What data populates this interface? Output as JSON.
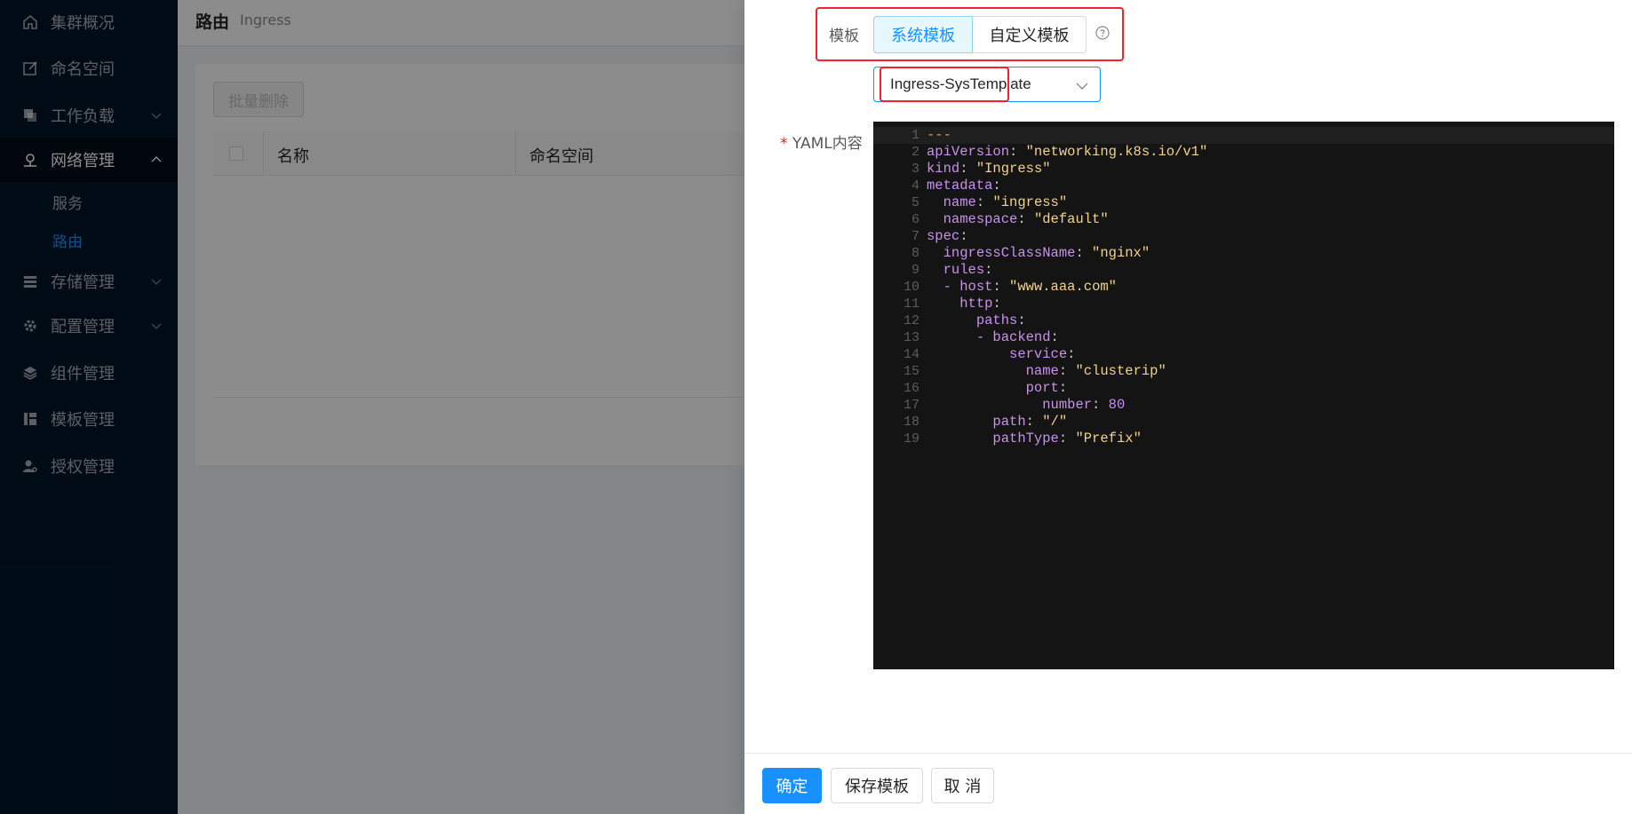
{
  "sidebar": {
    "items": [
      {
        "label": "集群概况",
        "icon": "home-icon"
      },
      {
        "label": "命名空间",
        "icon": "edit-icon"
      },
      {
        "label": "工作负载",
        "icon": "copy-icon"
      },
      {
        "label": "网络管理",
        "icon": "network-icon"
      },
      {
        "label": "存储管理",
        "icon": "database-icon"
      },
      {
        "label": "配置管理",
        "icon": "gear-icon"
      },
      {
        "label": "组件管理",
        "icon": "layers-icon"
      },
      {
        "label": "模板管理",
        "icon": "layout-icon"
      },
      {
        "label": "授权管理",
        "icon": "user-key-icon"
      }
    ],
    "sub_items": [
      {
        "label": "服务"
      },
      {
        "label": "路由"
      }
    ]
  },
  "page": {
    "title": "路由",
    "subtitle": "Ingress",
    "batch_delete": "批量删除",
    "columns": [
      "名称",
      "命名空间"
    ]
  },
  "drawer": {
    "template_label": "模板",
    "template_options": [
      "系统模板",
      "自定义模板"
    ],
    "selected_template": "Ingress-SysTemplate",
    "yaml_label": "YAML内容",
    "required_mark": "*",
    "yaml_lines": [
      "---",
      "apiVersion: \"networking.k8s.io/v1\"",
      "kind: \"Ingress\"",
      "metadata:",
      "  name: \"ingress\"",
      "  namespace: \"default\"",
      "spec:",
      "  ingressClassName: \"nginx\"",
      "  rules:",
      "  - host: \"www.aaa.com\"",
      "    http:",
      "      paths:",
      "      - backend:",
      "          service:",
      "            name: \"clusterip\"",
      "            port:",
      "              number: 80",
      "        path: \"/\"",
      "        pathType: \"Prefix\""
    ],
    "buttons": {
      "confirm": "确定",
      "save_template": "保存模板",
      "cancel": "取 消"
    }
  },
  "colors": {
    "primary": "#1890ff",
    "sidebar_bg": "#001529",
    "highlight_box": "#f5222d",
    "editor_bg": "#141414"
  }
}
